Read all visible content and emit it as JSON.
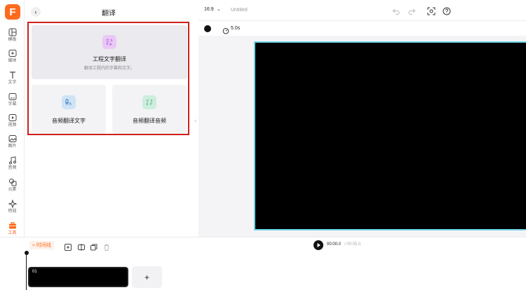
{
  "app": {
    "logo_letter": "F",
    "brand_color": "#ff6a1f"
  },
  "rail": {
    "items": [
      {
        "id": "template",
        "label": "模板",
        "icon": "layout-icon"
      },
      {
        "id": "media",
        "label": "媒体",
        "icon": "media-add-icon"
      },
      {
        "id": "text",
        "label": "文字",
        "icon": "text-icon"
      },
      {
        "id": "subtitle",
        "label": "字幕",
        "icon": "subtitle-icon"
      },
      {
        "id": "video",
        "label": "视频",
        "icon": "video-icon"
      },
      {
        "id": "image",
        "label": "图片",
        "icon": "image-icon"
      },
      {
        "id": "audio",
        "label": "音频",
        "icon": "music-icon"
      },
      {
        "id": "element",
        "label": "元素",
        "icon": "shapes-icon"
      },
      {
        "id": "effects",
        "label": "特效",
        "icon": "sparkle-icon"
      },
      {
        "id": "tools",
        "label": "工具",
        "icon": "toolbox-icon",
        "active": true
      }
    ]
  },
  "panel": {
    "title": "翻译",
    "cards": {
      "project": {
        "title": "工程文字翻译",
        "subtitle": "翻译工程内的字幕和文字。",
        "icon": "translate-icon"
      },
      "audio_text": {
        "title": "音频翻译文字",
        "icon": "audio-translate-icon"
      },
      "audio_audio": {
        "title": "音频翻译音频",
        "icon": "audio-to-audio-icon"
      }
    },
    "highlight_color": "#d11e1e"
  },
  "topbar": {
    "ratio": "16:9",
    "document_title": "Untitled"
  },
  "subbar": {
    "background_color": "#111111",
    "duration": "5.0s"
  },
  "canvas": {
    "frame_border_color": "#6fd6e6"
  },
  "timeline": {
    "tag": "时间线",
    "current_time": "00:00.0",
    "separator": " / ",
    "total_time": "00:05.0",
    "clip_number": "01",
    "add_symbol": "+"
  }
}
